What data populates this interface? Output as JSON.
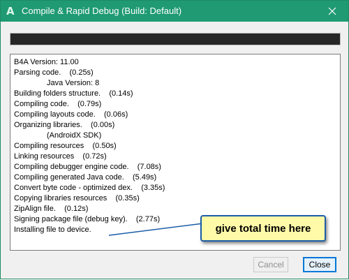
{
  "window": {
    "title": "Compile & Rapid Debug (Build: Default)",
    "app_icon_glyph": "A",
    "colors": {
      "titlebar": "#1f9a72",
      "callout_fill": "#fffaa8",
      "callout_border": "#1a5da8"
    }
  },
  "progress": {
    "value_percent": 100
  },
  "log": {
    "lines": [
      "B4A Version: 11.00",
      "Parsing code.    (0.25s)",
      "Java Version: 8",
      "Building folders structure.    (0.14s)",
      "Compiling code.    (0.79s)",
      "Compiling layouts code.    (0.06s)",
      "Organizing libraries.    (0.00s)",
      "(AndroidX SDK)",
      "Compiling resources    (0.50s)",
      "Linking resources    (0.72s)",
      "Compiling debugger engine code.    (7.08s)",
      "Compiling generated Java code.    (5.49s)",
      "Convert byte code - optimized dex.    (3.35s)",
      "Copying libraries resources    (0.35s)",
      "ZipAlign file.    (0.12s)",
      "Signing package file (debug key).    (2.77s)",
      "Installing file to device."
    ]
  },
  "callout": {
    "text": "give total time here"
  },
  "buttons": {
    "cancel_label": "Cancel",
    "close_label": "Close"
  }
}
